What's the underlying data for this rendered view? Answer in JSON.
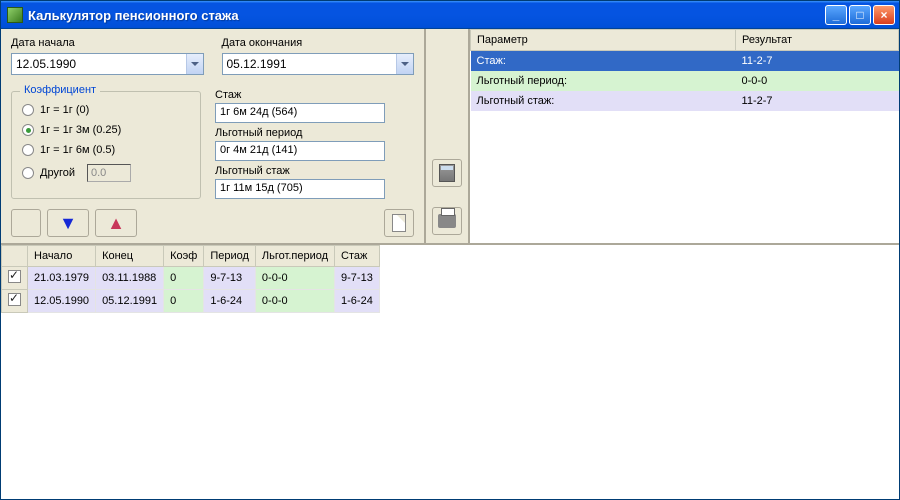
{
  "window": {
    "title": "Калькулятор пенсионного стажа"
  },
  "dates": {
    "start_label": "Дата начала",
    "end_label": "Дата окончания",
    "start_value": "12.05.1990",
    "end_value": "05.12.1991"
  },
  "coef": {
    "legend": "Коэффициент",
    "opt0": "1г = 1г (0)",
    "opt1": "1г = 1г 3м (0.25)",
    "opt2": "1г = 1г 6м (0.5)",
    "opt3": "Другой",
    "other_value": "0.0",
    "selected": 1
  },
  "result_fields": {
    "stazh_label": "Стаж",
    "stazh_value": "1г 6м 24д (564)",
    "lgp_label": "Льготный период",
    "lgp_value": "0г 4м 21д (141)",
    "lgs_label": "Льготный стаж",
    "lgs_value": "1г 11м 15д (705)"
  },
  "params_table": {
    "col_param": "Параметр",
    "col_result": "Результат",
    "rows": [
      {
        "param": "Стаж:",
        "result": "11-2-7"
      },
      {
        "param": "Льготный период:",
        "result": "0-0-0"
      },
      {
        "param": "Льготный стаж:",
        "result": "11-2-7"
      }
    ]
  },
  "grid": {
    "cols": {
      "start": "Начало",
      "end": "Конец",
      "coef": "Коэф",
      "period": "Период",
      "lgp": "Льгот.период",
      "stazh": "Стаж"
    },
    "rows": [
      {
        "checked": true,
        "start": "21.03.1979",
        "end": "03.11.1988",
        "coef": "0",
        "period": "9-7-13",
        "lgp": "0-0-0",
        "stazh": "9-7-13"
      },
      {
        "checked": true,
        "start": "12.05.1990",
        "end": "05.12.1991",
        "coef": "0",
        "period": "1-6-24",
        "lgp": "0-0-0",
        "stazh": "1-6-24"
      }
    ]
  }
}
